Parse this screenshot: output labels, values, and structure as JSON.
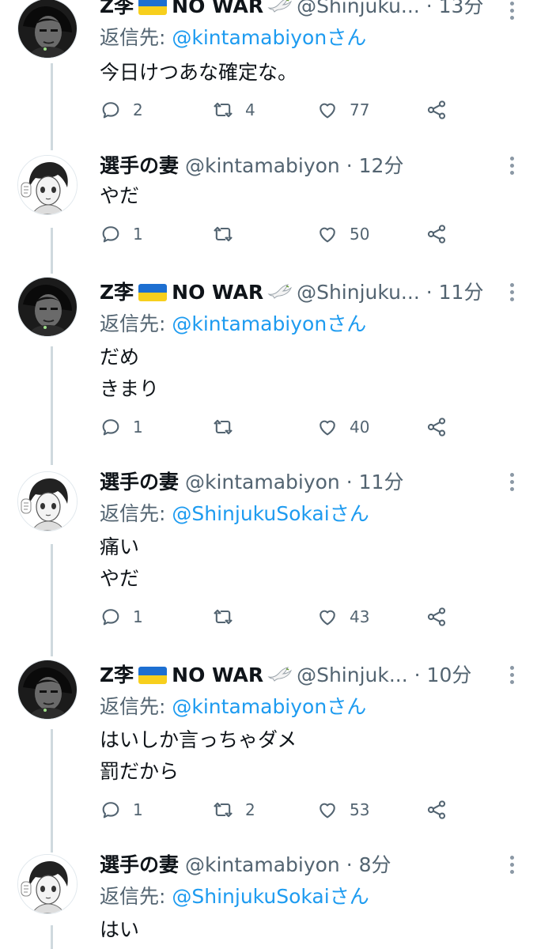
{
  "tweets": [
    {
      "name": "Z李",
      "handle": "@Shinjuku...",
      "time": "· 13分",
      "reply_prefix": "返信先: ",
      "reply_to": "@kintamabiyonさん",
      "text": "今日けつあな確定な。",
      "replies": "2",
      "retweets": "4",
      "likes": "77"
    },
    {
      "name": "選手の妻",
      "handle": "@kintamabiyon",
      "time": "· 12分",
      "text": "やだ",
      "replies": "1",
      "retweets": "",
      "likes": "50"
    },
    {
      "name": "Z李",
      "handle": "@Shinjuku...",
      "time": "· 11分",
      "reply_prefix": "返信先: ",
      "reply_to": "@kintamabiyonさん",
      "text": "だめ\nきまり",
      "replies": "1",
      "retweets": "",
      "likes": "40"
    },
    {
      "name": "選手の妻",
      "handle": "@kintamabiyon",
      "time": "· 11分",
      "reply_prefix": "返信先: ",
      "reply_to": "@ShinjukuSokaiさん",
      "text": "痛い\nやだ",
      "replies": "1",
      "retweets": "",
      "likes": "43"
    },
    {
      "name": "Z李",
      "handle": "@Shinjuk...",
      "time": "· 10分",
      "reply_prefix": "返信先: ",
      "reply_to": "@kintamabiyonさん",
      "text": "はいしか言っちゃダメ\n罰だから",
      "replies": "1",
      "retweets": "2",
      "likes": "53"
    },
    {
      "name": "選手の妻",
      "handle": "@kintamabiyon",
      "time": "· 8分",
      "reply_prefix": "返信先: ",
      "reply_to": "@ShinjukuSokaiさん",
      "text": "はい"
    }
  ],
  "flag_badge": "NO WAR",
  "icons": {
    "reply": "reply-icon",
    "retweet": "retweet-icon",
    "like": "heart-icon",
    "share": "share-icon",
    "more": "more-vertical-icon",
    "dove": "dove-icon",
    "flag": "ukraine-flag-icon"
  },
  "colors": {
    "link": "#1d9bf0",
    "muted": "#536471",
    "flag_blue": "#1d6fd1",
    "flag_yellow": "#f7cf1d"
  }
}
